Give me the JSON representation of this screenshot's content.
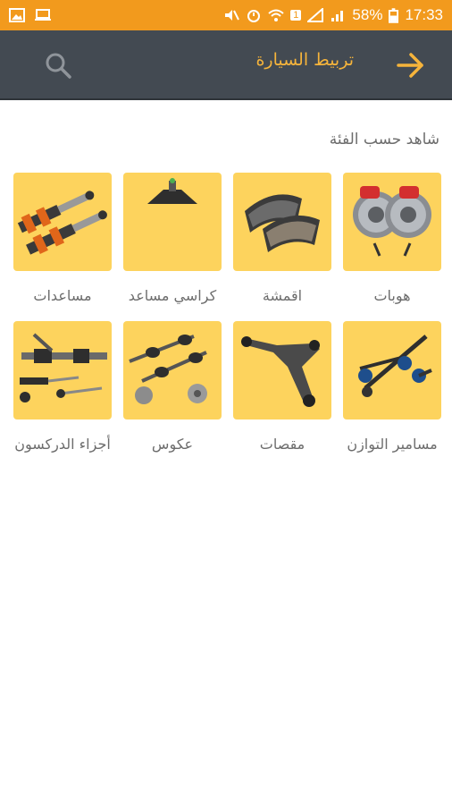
{
  "status_bar": {
    "battery": "58%",
    "time": "17:33",
    "notification_badge": "1"
  },
  "app_bar": {
    "title": "تربيط السيارة",
    "icons": [
      "search-icon",
      "arrow-back-icon"
    ]
  },
  "section": {
    "title": "شاهد حسب الفئة"
  },
  "categories": [
    {
      "label": "هوبات",
      "icon": "brake-disc"
    },
    {
      "label": "اقمشة",
      "icon": "brake-pads"
    },
    {
      "label": "كراسي مساعد",
      "icon": "strut-mount"
    },
    {
      "label": "مساعدات",
      "icon": "coilover"
    },
    {
      "label": "مسامير التوازن",
      "icon": "stabilizer-link"
    },
    {
      "label": "مقصات",
      "icon": "control-arm"
    },
    {
      "label": "عكوس",
      "icon": "drive-shaft"
    },
    {
      "label": "أجزاء الدركسون",
      "icon": "steering-rack"
    }
  ],
  "colors": {
    "status_bar": "#f29a1d",
    "app_bar": "#434a52",
    "accent": "#f6b43b",
    "tile": "#fdd35d"
  }
}
